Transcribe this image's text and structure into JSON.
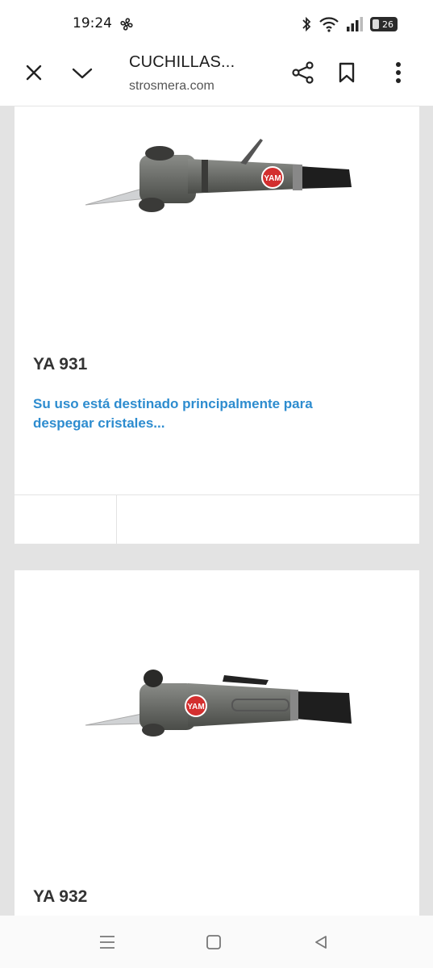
{
  "status_bar": {
    "time": "19:24",
    "battery_level": "26",
    "icons": [
      "fan-icon",
      "bluetooth-icon",
      "wifi-icon",
      "signal-icon",
      "battery-icon"
    ]
  },
  "toolbar": {
    "title": "CUCHILLAS...",
    "url": "strosmera.com",
    "icons": [
      "close-icon",
      "chevron-down-icon",
      "share-icon",
      "bookmark-icon",
      "more-vert-icon"
    ]
  },
  "products": [
    {
      "title": "YA 931",
      "description": "Su uso está destinado principalmente para despegar cristales...",
      "logo_text": "YAM"
    },
    {
      "title": "YA 932",
      "logo_text": "YAM"
    }
  ],
  "nav_bar": {
    "icons": [
      "recents-icon",
      "home-icon",
      "back-icon"
    ]
  },
  "colors": {
    "accent_link": "#2d8ccf",
    "page_background": "#e3e3e3",
    "card_background": "#ffffff",
    "tool_body": "#6a6c68",
    "logo_red": "#d32f2f"
  }
}
